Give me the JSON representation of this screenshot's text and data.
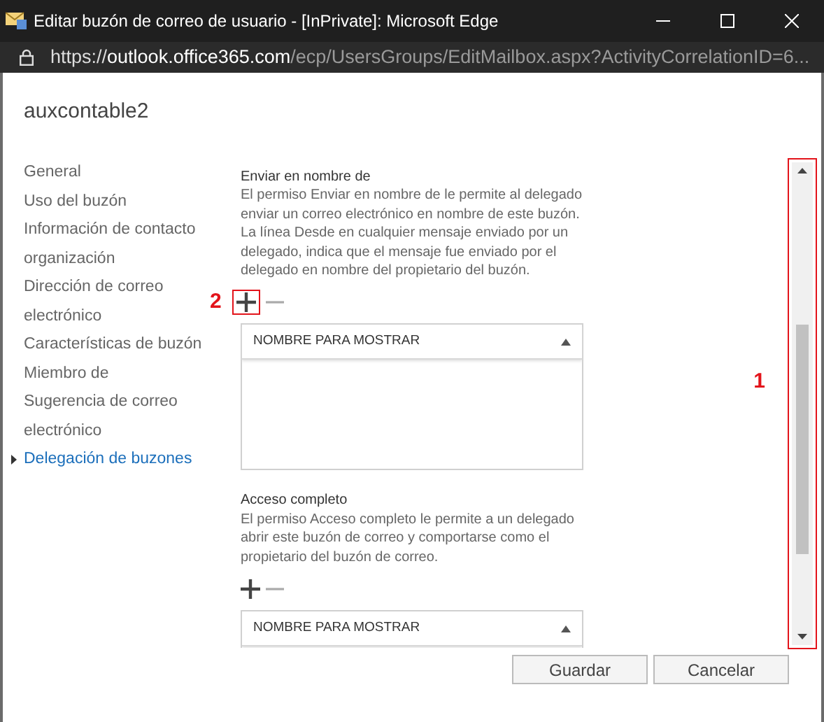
{
  "window": {
    "title": "Editar buzón de correo de usuario - [InPrivate]: Microsoft Edge"
  },
  "address_bar": {
    "scheme": "https://",
    "host": "outlook.office365.com",
    "path": "/ecp/UsersGroups/EditMailbox.aspx?ActivityCorrelationID=6..."
  },
  "mailbox_name": "auxcontable2",
  "nav_items": [
    {
      "label": "General",
      "selected": false
    },
    {
      "label": "Uso del buzón",
      "selected": false
    },
    {
      "label": "Información de contacto",
      "selected": false
    },
    {
      "label": "organización",
      "selected": false
    },
    {
      "label": "Dirección de correo electrónico",
      "selected": false
    },
    {
      "label": "Características de buzón",
      "selected": false
    },
    {
      "label": "Miembro de",
      "selected": false
    },
    {
      "label": "Sugerencia de correo electrónico",
      "selected": false
    },
    {
      "label": "Delegación de buzones",
      "selected": true
    }
  ],
  "sections": [
    {
      "title": "Enviar en nombre de",
      "description": "El permiso Enviar en nombre de le permite al delegado enviar un correo electrónico en nombre de este buzón. La línea Desde en cualquier mensaje enviado por un delegado, indica que el mensaje fue enviado por el delegado en nombre del propietario del buzón.",
      "column": "NOMBRE PARA MOSTRAR",
      "annotation": "2",
      "list_open": true
    },
    {
      "title": "Acceso completo",
      "description": "El permiso Acceso completo le permite a un delegado abrir este buzón de correo y comportarse como el propietario del buzón de correo.",
      "column": "NOMBRE PARA MOSTRAR",
      "list_open": false
    }
  ],
  "scrollbar_annotation": "1",
  "buttons": [
    "Guardar",
    "Cancelar"
  ]
}
